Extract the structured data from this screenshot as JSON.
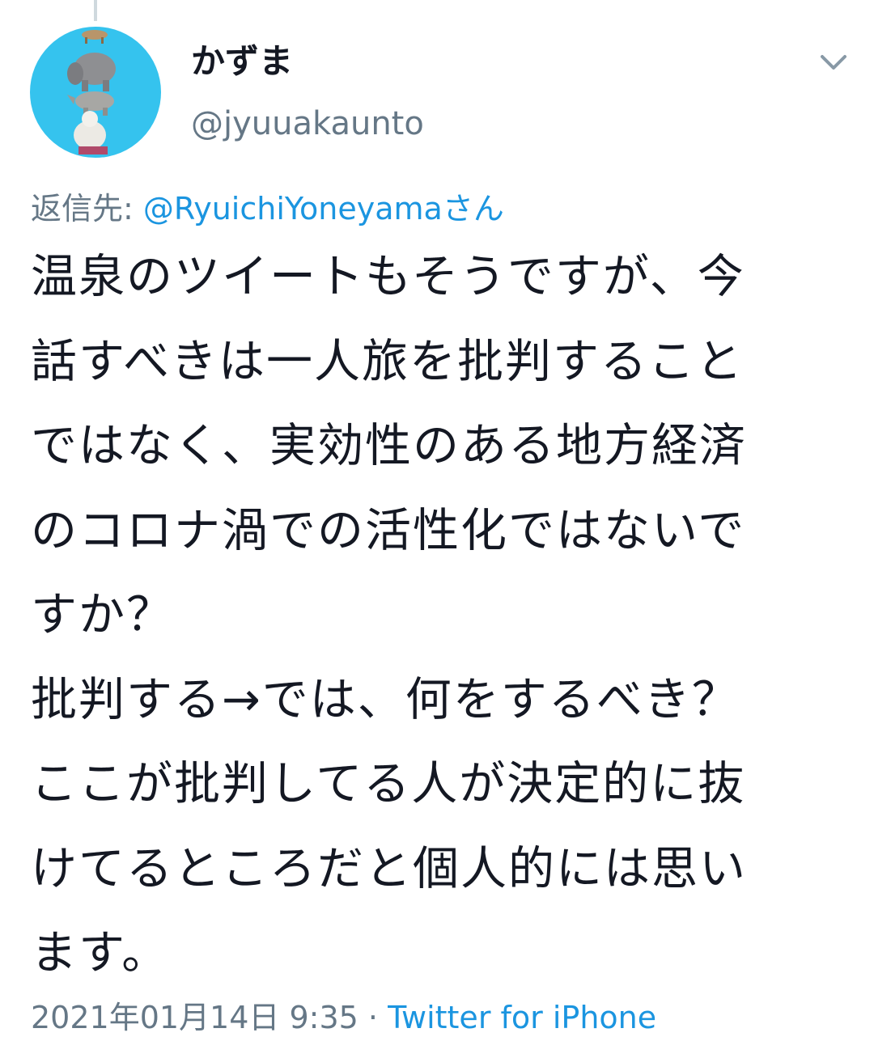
{
  "tweet": {
    "display_name": "かずま",
    "handle": "@jyuuakaunto",
    "reply_prefix": "返信先: ",
    "reply_mention": "@RyuichiYoneyamaさん",
    "body_lines": [
      "温泉のツイートもそうですが、今",
      "話すべきは一人旅を批判すること",
      "ではなく、実効性のある地方経済",
      "のコロナ渦での活性化ではないで",
      "すか？",
      "批判する→では、何をするべき？",
      "ここが批判してる人が決定的に抜",
      "けてるところだと個人的には思い",
      "ます。"
    ],
    "timestamp": "2021年01月14日 9:35",
    "separator": " · ",
    "source": "Twitter for iPhone"
  },
  "icons": {
    "menu": "chevron-down-icon",
    "avatar": "animal-stack-avatar"
  },
  "colors": {
    "text": "#141823",
    "secondary": "#657786",
    "link": "#1b95e0",
    "avatar_bg": "#35c3ee"
  }
}
